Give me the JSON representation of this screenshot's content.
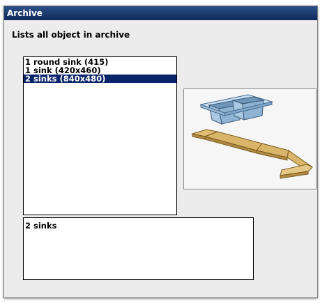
{
  "window": {
    "title": "Archive"
  },
  "description": "Lists all object in archive",
  "archive_list": {
    "items": [
      {
        "label": "1 round sink (415)"
      },
      {
        "label": "1 sink (420x460)"
      },
      {
        "label": "2 sinks (840x480)"
      }
    ],
    "selected_index": 2
  },
  "preview": {
    "icon": "double-sink-icon"
  },
  "name_field": {
    "value": "2 sinks"
  },
  "colors": {
    "titlebar": "#0f2a5c",
    "selection": "#0a246a",
    "sink": "#7fa6c8",
    "countertop": "#d9b56a"
  }
}
